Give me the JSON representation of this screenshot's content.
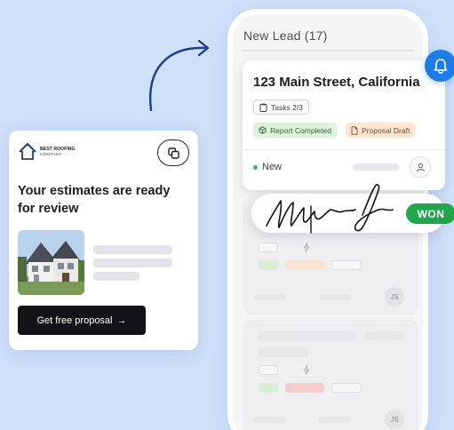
{
  "board": {
    "column_title": "New Lead (17)",
    "lead": {
      "address": "123 Main Street, California",
      "tasks": "Tasks 2/3",
      "tag_report": "Report Completed",
      "tag_proposal": "Proposal Draft",
      "status": "New"
    },
    "ghost_assignee_1": "JS",
    "ghost_assignee_2": "JS"
  },
  "badge": {
    "won": "WON"
  },
  "estimate_card": {
    "logo_line1": "BEST ROOFING",
    "logo_line2": "COMPANY",
    "headline": "Your estimates are ready for review",
    "cta_label": "Get free proposal",
    "cta_arrow": "→"
  },
  "colors": {
    "accent_blue": "#1f7be6",
    "won_green": "#1fa64a",
    "report_bg": "#dff2dc",
    "proposal_bg": "#fde6d3",
    "cta_bg": "#121316",
    "background": "#cfe0f9"
  },
  "icons": [
    "bell-icon",
    "clipboard-icon",
    "cube-icon",
    "document-icon",
    "user-icon",
    "copy-icon",
    "house-icon",
    "arrow-icon",
    "bolt-icon"
  ]
}
